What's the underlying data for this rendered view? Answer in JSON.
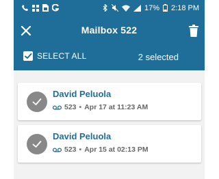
{
  "status_bar": {
    "left_icons": [
      "phone-call-icon",
      "grid-icon",
      "sim-icon",
      "g-icon"
    ],
    "right_icons": [
      "bluetooth-icon",
      "mute-icon",
      "wifi-icon",
      "signal-icon"
    ],
    "battery": "17%",
    "battery_icon": "battery-icon",
    "time": "2:18 PM"
  },
  "toolbar": {
    "title": "Mailbox 522",
    "close_icon": "close-icon",
    "delete_icon": "trash-icon"
  },
  "selection": {
    "select_all_label": "SELECT ALL",
    "select_all_checked": true,
    "selected_count_text": "2 selected"
  },
  "messages": [
    {
      "name": "David Peluola",
      "mailbox": "523",
      "separator": "•",
      "datetime": "Apr 17 at 11:23 AM",
      "selected": true
    },
    {
      "name": "David Peluola",
      "mailbox": "523",
      "separator": "•",
      "datetime": "Apr 15 at 02:13 PM",
      "selected": true
    }
  ],
  "colors": {
    "primary": "#1f6e99",
    "avatar_selected": "#888888",
    "list_background": "#f2f2f2"
  }
}
